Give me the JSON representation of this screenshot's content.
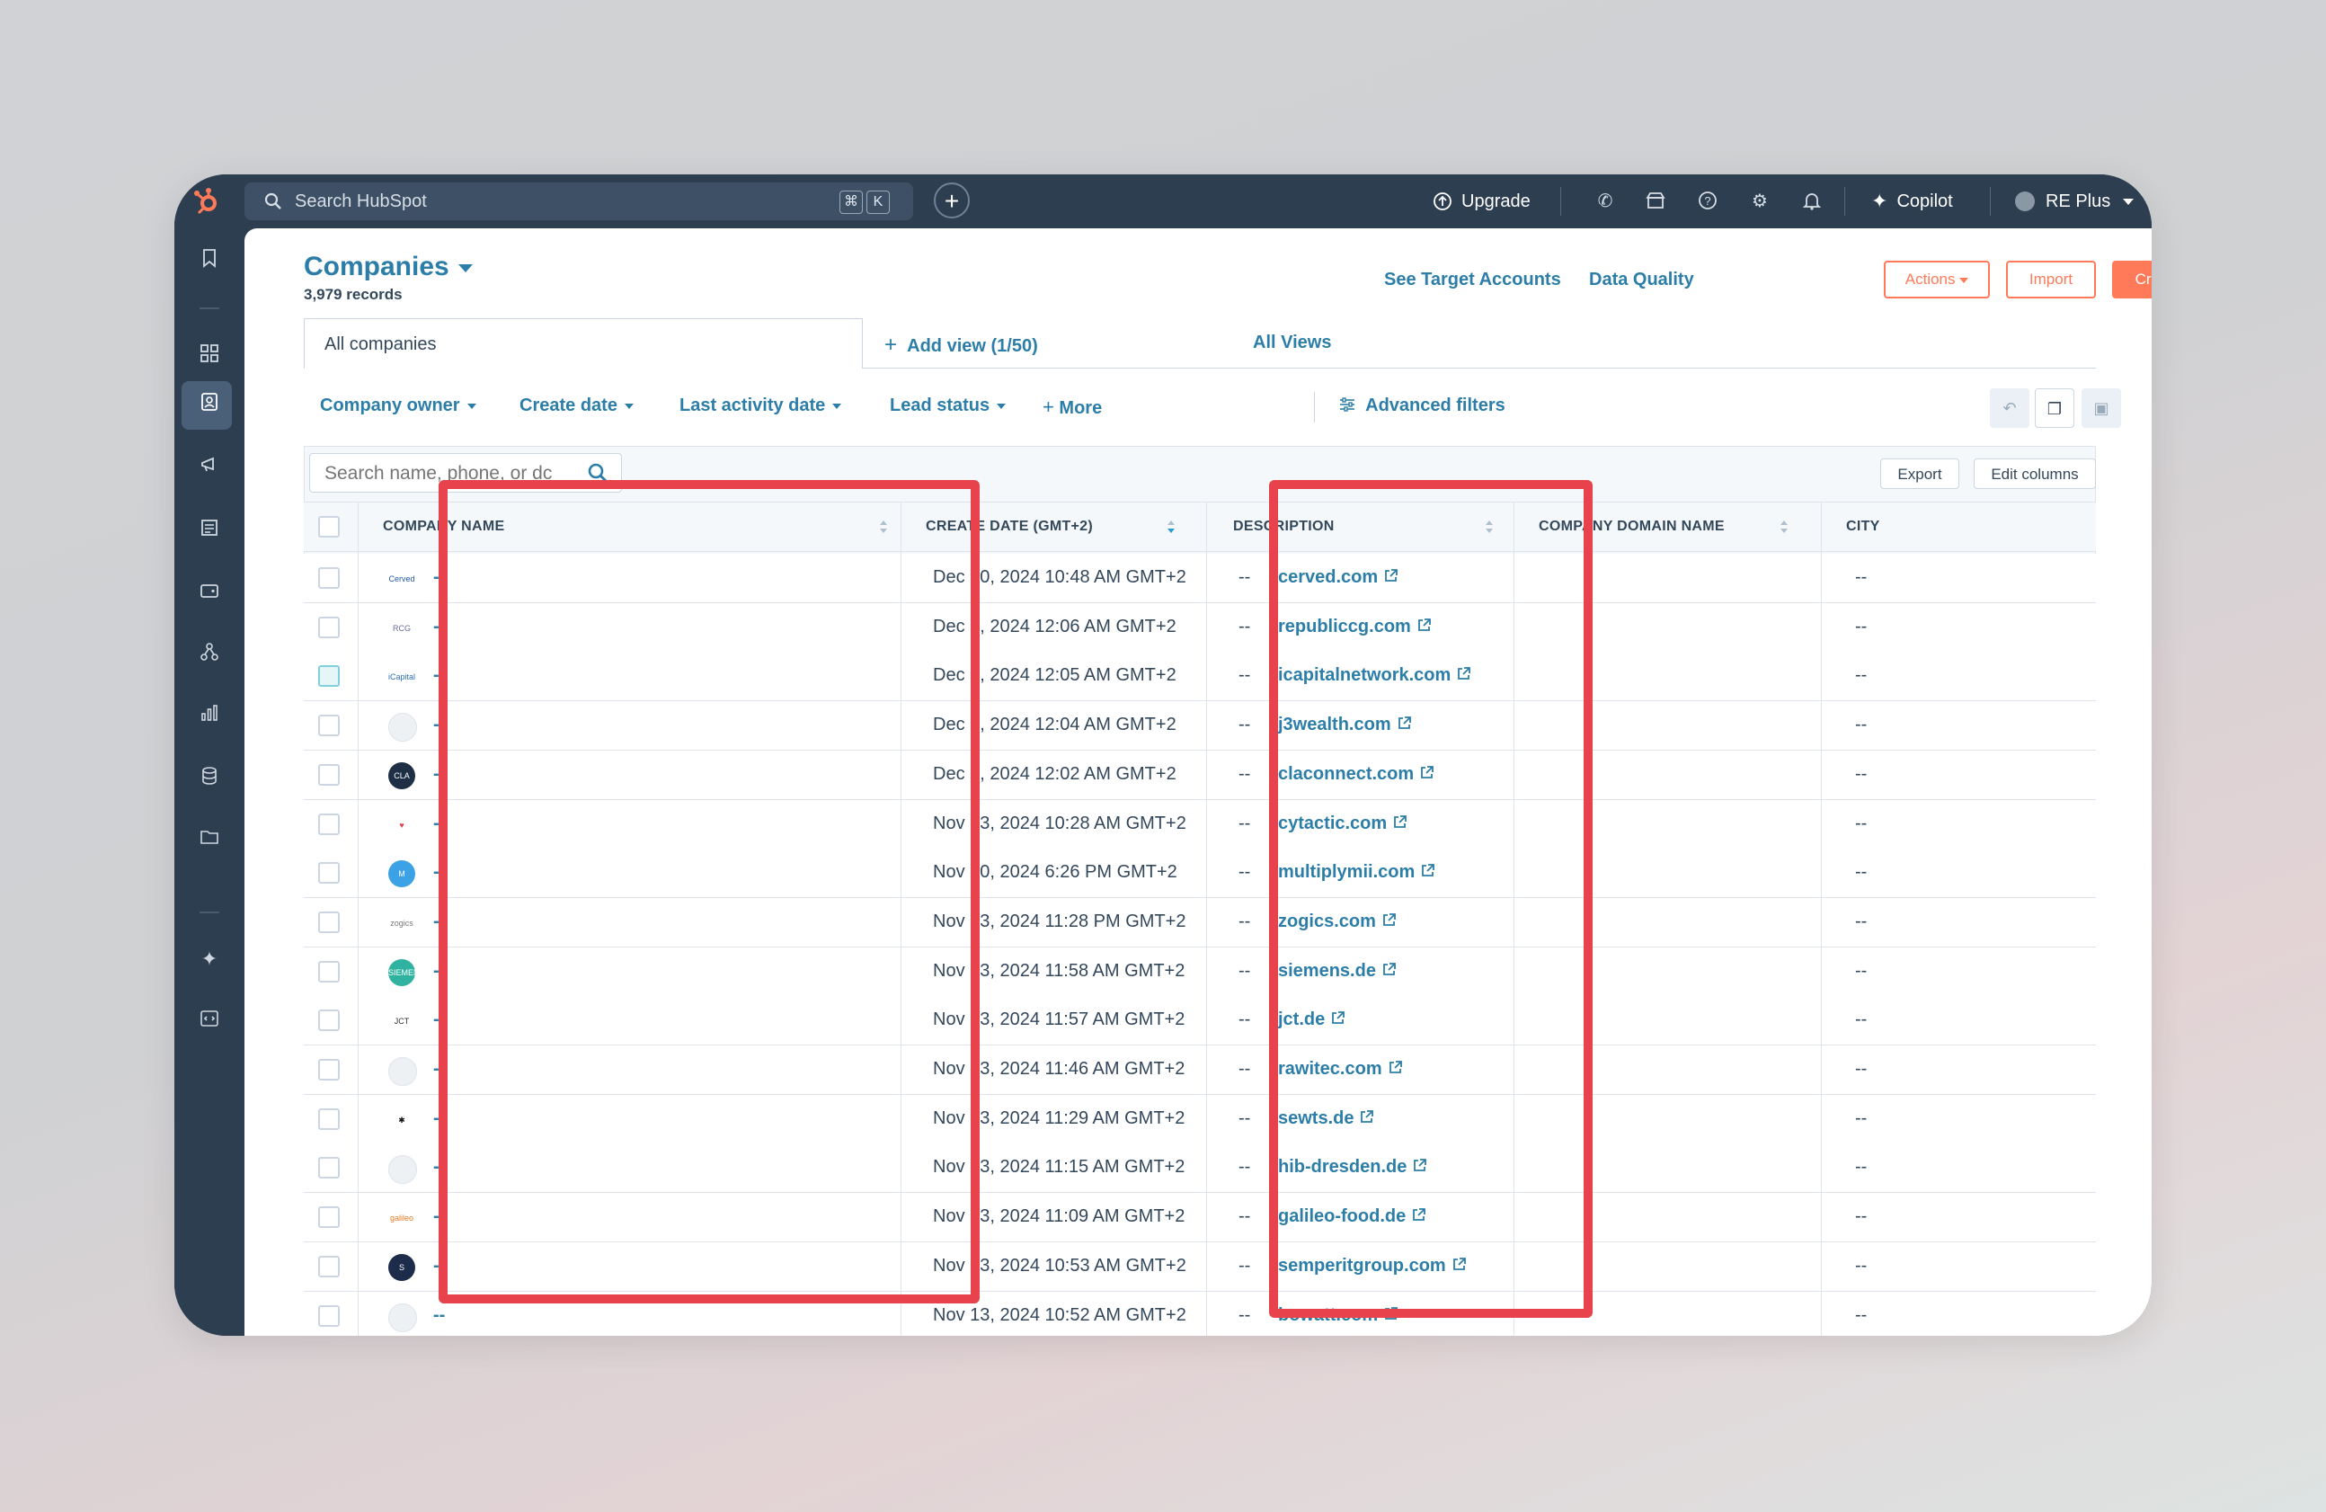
{
  "topbar": {
    "search_placeholder": "Search HubSpot",
    "shortcut_keys": [
      "⌘",
      "K"
    ],
    "upgrade_label": "Upgrade",
    "copilot_label": "Copilot",
    "account_label": "RE Plus"
  },
  "header": {
    "title": "Companies",
    "records": "3,979 records",
    "see_target_accounts": "See Target Accounts",
    "data_quality": "Data Quality",
    "actions_label": "Actions",
    "import_label": "Import",
    "create_label": "Create company"
  },
  "views": {
    "active_view": "All companies",
    "add_view": "Add view (1/50)",
    "all_views": "All Views"
  },
  "filters": [
    {
      "label": "Company owner"
    },
    {
      "label": "Create date"
    },
    {
      "label": "Last activity date"
    },
    {
      "label": "Lead status"
    }
  ],
  "more_label": "More",
  "advanced_filters_label": "Advanced filters",
  "table": {
    "search_placeholder": "Search name, phone, or dc",
    "export_label": "Export",
    "edit_columns_label": "Edit columns",
    "columns": {
      "company_name": "COMPANY NAME",
      "create_date": "CREATE DATE (GMT+2)",
      "description": "DESCRIPTION",
      "domain": "COMPANY DOMAIN NAME",
      "city": "CITY"
    },
    "rows": [
      {
        "name": "--",
        "date": "Dec 10, 2024 10:48 AM GMT+2",
        "desc": "--",
        "domain": "cerved.com",
        "city": "--",
        "logo": "Cerved",
        "logo_bg": "#ffffff",
        "logo_fg": "#1e5aa8"
      },
      {
        "name": "--",
        "date": "Dec 6, 2024 12:06 AM GMT+2",
        "desc": "--",
        "domain": "republiccg.com",
        "city": "--",
        "logo": "RCG",
        "logo_bg": "#ffffff",
        "logo_fg": "#6b6b9a"
      },
      {
        "name": "--",
        "date": "Dec 6, 2024 12:05 AM GMT+2",
        "desc": "--",
        "domain": "icapitalnetwork.com",
        "city": "--",
        "logo": "iCapital",
        "logo_bg": "#ffffff",
        "logo_fg": "#2c6fb5"
      },
      {
        "name": "--",
        "date": "Dec 6, 2024 12:04 AM GMT+2",
        "desc": "--",
        "domain": "j3wealth.com",
        "city": "--",
        "logo": "",
        "logo_bg": "#eef1f4",
        "logo_fg": "#cbd6e2"
      },
      {
        "name": "--",
        "date": "Dec 6, 2024 12:02 AM GMT+2",
        "desc": "--",
        "domain": "claconnect.com",
        "city": "--",
        "logo": "CLA",
        "logo_bg": "#1f2f45",
        "logo_fg": "#ffffff"
      },
      {
        "name": "--",
        "date": "Nov 23, 2024 10:28 AM GMT+2",
        "desc": "--",
        "domain": "cytactic.com",
        "city": "--",
        "logo": "♥",
        "logo_bg": "#ffffff",
        "logo_fg": "#e0444c"
      },
      {
        "name": "--",
        "date": "Nov 20, 2024 6:26 PM GMT+2",
        "desc": "--",
        "domain": "multiplymii.com",
        "city": "--",
        "logo": "M",
        "logo_bg": "#3ba2e6",
        "logo_fg": "#ffffff"
      },
      {
        "name": "--",
        "date": "Nov 13, 2024 11:28 PM GMT+2",
        "desc": "--",
        "domain": "zogics.com",
        "city": "--",
        "logo": "zogics",
        "logo_bg": "#ffffff",
        "logo_fg": "#777777"
      },
      {
        "name": "--",
        "date": "Nov 13, 2024 11:58 AM GMT+2",
        "desc": "--",
        "domain": "siemens.de",
        "city": "--",
        "logo": "SIEMENS",
        "logo_bg": "#2fb3a0",
        "logo_fg": "#ffffff"
      },
      {
        "name": "--",
        "date": "Nov 13, 2024 11:57 AM GMT+2",
        "desc": "--",
        "domain": "jct.de",
        "city": "--",
        "logo": "JCT",
        "logo_bg": "#ffffff",
        "logo_fg": "#333333"
      },
      {
        "name": "--",
        "date": "Nov 13, 2024 11:46 AM GMT+2",
        "desc": "--",
        "domain": "rawitec.com",
        "city": "--",
        "logo": "",
        "logo_bg": "#eef1f4",
        "logo_fg": "#cbd6e2"
      },
      {
        "name": "--",
        "date": "Nov 13, 2024 11:29 AM GMT+2",
        "desc": "--",
        "domain": "sewts.de",
        "city": "--",
        "logo": "✱",
        "logo_bg": "#ffffff",
        "logo_fg": "#111111"
      },
      {
        "name": "--",
        "date": "Nov 13, 2024 11:15 AM GMT+2",
        "desc": "--",
        "domain": "hib-dresden.de",
        "city": "--",
        "logo": "",
        "logo_bg": "#eef1f4",
        "logo_fg": "#cbd6e2"
      },
      {
        "name": "--",
        "date": "Nov 13, 2024 11:09 AM GMT+2",
        "desc": "--",
        "domain": "galileo-food.de",
        "city": "--",
        "logo": "galileo",
        "logo_bg": "#ffffff",
        "logo_fg": "#e07a1f"
      },
      {
        "name": "--",
        "date": "Nov 13, 2024 10:53 AM GMT+2",
        "desc": "--",
        "domain": "semperitgroup.com",
        "city": "--",
        "logo": "S",
        "logo_bg": "#1c2c4a",
        "logo_fg": "#ffffff"
      },
      {
        "name": "--",
        "date": "Nov 13, 2024 10:52 AM GMT+2",
        "desc": "--",
        "domain": "bowatt.com",
        "city": "--",
        "logo": "",
        "logo_bg": "#eef1f4",
        "logo_fg": "#cbd6e2"
      }
    ]
  },
  "colors": {
    "accent": "#2c7ea8",
    "orange": "#ff7a59",
    "navy": "#2d3e50",
    "highlight": "#e8434c"
  }
}
